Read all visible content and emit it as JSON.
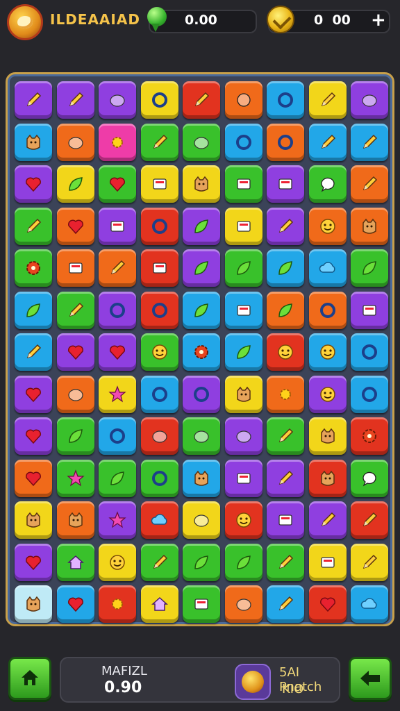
{
  "header": {
    "title": "ILDEAAIAD",
    "gems": "0.00",
    "coins": "0  00",
    "add_label": "+"
  },
  "footer": {
    "label": "MAFIZL",
    "value": "0.90",
    "match_title": "5AI Pnatch",
    "match_sub": "KIO"
  },
  "colors": {
    "background": "#26262b",
    "board": "#3b4358",
    "board_border": "#c8a04a",
    "button_green": "#4fbf2f",
    "title_gold": "#f5c34a"
  },
  "board": {
    "rows": 13,
    "cols": 9,
    "tiles": [
      [
        "purple:pencil",
        "purple:pencil",
        "purple:blob",
        "yellow:ring",
        "red:eraser",
        "orange:circle",
        "blue:trophy",
        "yellow:pencil",
        "purple:blob"
      ],
      [
        "blue:cat",
        "orange:egg",
        "pink:sun",
        "green:pencil",
        "green:blob",
        "blue:bow",
        "orange:eye",
        "blue:rocket",
        "blue:brush"
      ],
      [
        "purple:heart",
        "yellow:leaf",
        "green:heart",
        "yellow:stripes",
        "yellow:cat",
        "green:square",
        "purple:card",
        "green:bubble",
        "orange:pencil"
      ],
      [
        "green:pencil",
        "orange:apple",
        "purple:picture",
        "red:ring",
        "purple:leaf",
        "yellow:dots",
        "purple:pencil",
        "orange:smile",
        "orange:cat"
      ],
      [
        "green:gear",
        "orange:bag",
        "orange:pencil",
        "red:card",
        "purple:feather",
        "green:banana",
        "blue:leaf",
        "blue:cloud",
        "green:leaf"
      ],
      [
        "blue:ribbon",
        "green:pencil",
        "purple:ring",
        "red:target",
        "blue:leaf",
        "blue:card",
        "orange:bell",
        "orange:target",
        "purple:dots"
      ],
      [
        "blue:stick",
        "purple:heart",
        "purple:heart",
        "green:smile",
        "blue:gear",
        "blue:pepper",
        "red:smile",
        "blue:smile",
        "blue:ring"
      ],
      [
        "purple:bug",
        "orange:blob",
        "yellow:star",
        "blue:ring",
        "purple:ring",
        "yellow:cat",
        "orange:sun",
        "purple:smile",
        "blue:cross"
      ],
      [
        "purple:heart",
        "green:leaf",
        "blue:lollipop",
        "red:blob",
        "green:balloon",
        "purple:blob",
        "green:pencil",
        "yellow:robot",
        "red:gear"
      ],
      [
        "orange:heart",
        "green:bolt",
        "green:leaf",
        "green:ring",
        "blue:person",
        "purple:card",
        "purple:eraser",
        "red:fox",
        "green:bubble"
      ],
      [
        "yellow:cat",
        "orange:cat",
        "purple:gem",
        "red:ghost",
        "yellow:balloon",
        "red:face",
        "purple:books",
        "purple:pencil",
        "red:eraser"
      ],
      [
        "purple:heart",
        "green:house",
        "yellow:tomato",
        "green:pencil",
        "green:carrot",
        "green:feather",
        "green:pencil",
        "yellow:can",
        "yellow:bottle"
      ],
      [
        "white:monster",
        "blue:heart",
        "red:shell",
        "yellow:house",
        "green:cheese",
        "orange:egg",
        "blue:pencil",
        "red:heart",
        "blue:cloud"
      ]
    ]
  }
}
